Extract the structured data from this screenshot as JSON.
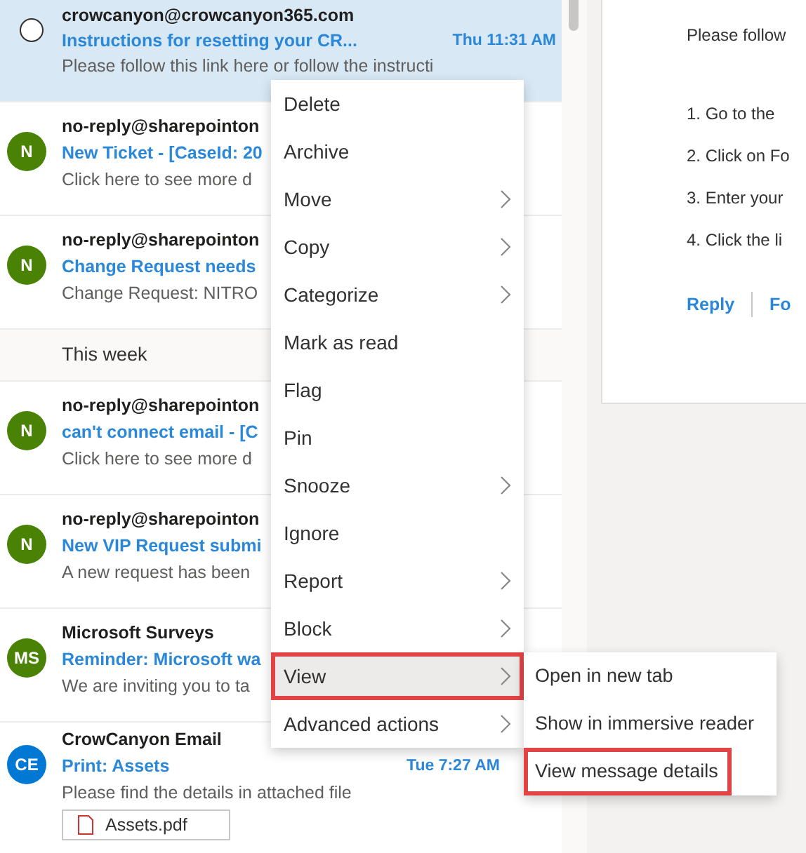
{
  "mail_list": [
    {
      "kind": "message",
      "selected": true,
      "sender": "crowcanyon@crowcanyon365.com",
      "subject": "Instructions for resetting your CR...",
      "time": "Thu 11:31 AM",
      "preview": "Please follow this link here or follow the instructi"
    },
    {
      "kind": "message",
      "selected": false,
      "initials": "N",
      "color": "#498205",
      "sender": "no-reply@sharepointon",
      "subject": "New Ticket - [CaseId: 20",
      "preview": "Click here to see more d"
    },
    {
      "kind": "message",
      "selected": false,
      "initials": "N",
      "color": "#498205",
      "sender": "no-reply@sharepointon",
      "subject": "Change Request needs",
      "preview": "Change Request: NITRO"
    },
    {
      "kind": "header",
      "label": "This week"
    },
    {
      "kind": "message",
      "selected": false,
      "initials": "N",
      "color": "#498205",
      "sender": "no-reply@sharepointon",
      "subject": "can't connect email - [C",
      "preview": "Click here to see more d"
    },
    {
      "kind": "message",
      "selected": false,
      "initials": "N",
      "color": "#498205",
      "sender": "no-reply@sharepointon",
      "subject": "New VIP Request submi",
      "preview": "A new request has been"
    },
    {
      "kind": "message",
      "selected": false,
      "initials": "MS",
      "color": "#498205",
      "sender": "Microsoft Surveys",
      "subject": "Reminder: Microsoft wa",
      "preview": "We are inviting you to ta"
    },
    {
      "kind": "message",
      "selected": false,
      "initials": "CE",
      "color": "#0078d4",
      "sender": "CrowCanyon Email",
      "subject": "Print: Assets",
      "time": "Tue 7:27 AM",
      "preview": "Please find the details in attached file",
      "attachment": "Assets.pdf"
    }
  ],
  "reading_pane": {
    "lines": [
      "Please follow",
      "1. Go to the",
      "2. Click on Fo",
      "3. Enter your",
      "4. Click the li"
    ],
    "actions": [
      "Reply",
      "Fo"
    ]
  },
  "context_menu": [
    {
      "label": "Delete",
      "submenu": false,
      "selected": false
    },
    {
      "label": "Archive",
      "submenu": false,
      "selected": false
    },
    {
      "label": "Move",
      "submenu": true,
      "selected": false
    },
    {
      "label": "Copy",
      "submenu": true,
      "selected": false
    },
    {
      "label": "Categorize",
      "submenu": true,
      "selected": false
    },
    {
      "label": "Mark as read",
      "submenu": false,
      "selected": false
    },
    {
      "label": "Flag",
      "submenu": false,
      "selected": false
    },
    {
      "label": "Pin",
      "submenu": false,
      "selected": false
    },
    {
      "label": "Snooze",
      "submenu": true,
      "selected": false
    },
    {
      "label": "Ignore",
      "submenu": false,
      "selected": false
    },
    {
      "label": "Report",
      "submenu": true,
      "selected": false
    },
    {
      "label": "Block",
      "submenu": true,
      "selected": false
    },
    {
      "label": "View",
      "submenu": true,
      "selected": true
    },
    {
      "label": "Advanced actions",
      "submenu": true,
      "selected": false
    }
  ],
  "submenu": [
    {
      "label": "Open in new tab",
      "highlighted": false
    },
    {
      "label": "Show in immersive reader",
      "highlighted": false
    },
    {
      "label": "View message details",
      "highlighted": true
    }
  ]
}
